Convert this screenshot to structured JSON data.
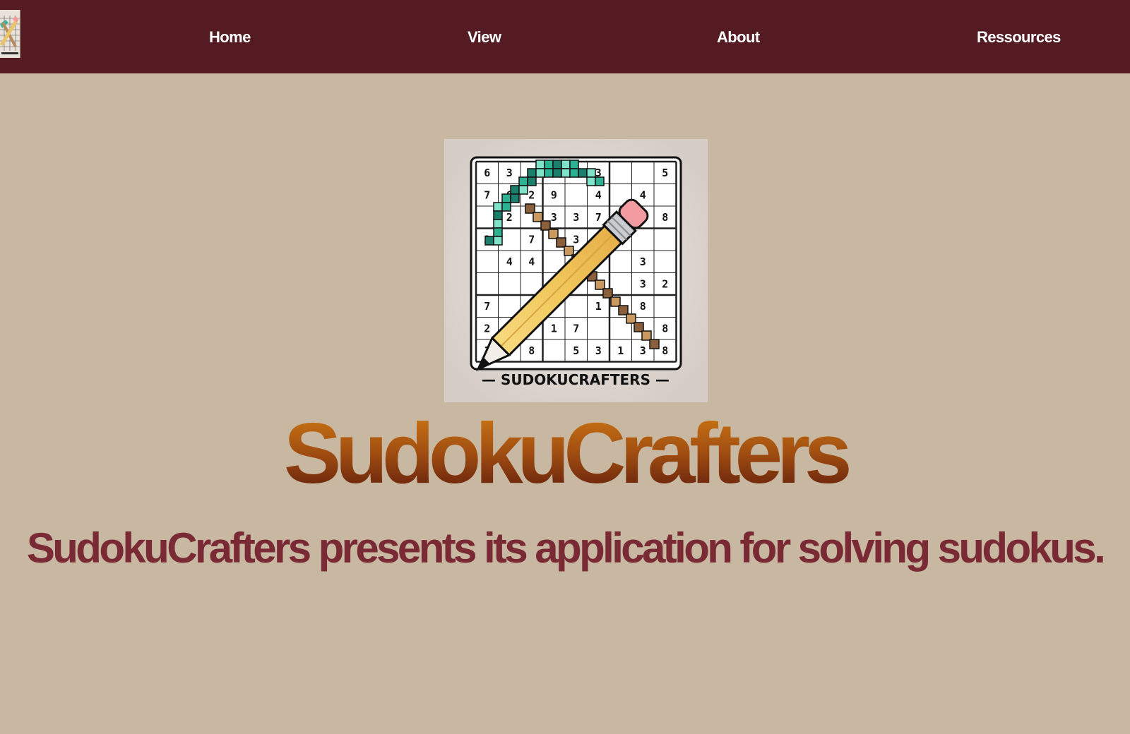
{
  "nav": {
    "logo_icon": "sudokucrafters-logo-icon",
    "items": [
      {
        "label": "Home"
      },
      {
        "label": "View"
      },
      {
        "label": "About"
      },
      {
        "label": "Ressources"
      }
    ]
  },
  "hero": {
    "logo_caption": "— SUDOKUCRAFTERS —",
    "title": "SudokuCrafters",
    "subtitle": "SudokuCrafters presents its application for solving sudokus."
  },
  "colors": {
    "nav_background": "#541b23",
    "page_background": "#c8b7a1",
    "title_gradient_top": "#cf7a14",
    "title_gradient_bottom": "#5e1b0b",
    "subtitle": "#7a2a35"
  }
}
